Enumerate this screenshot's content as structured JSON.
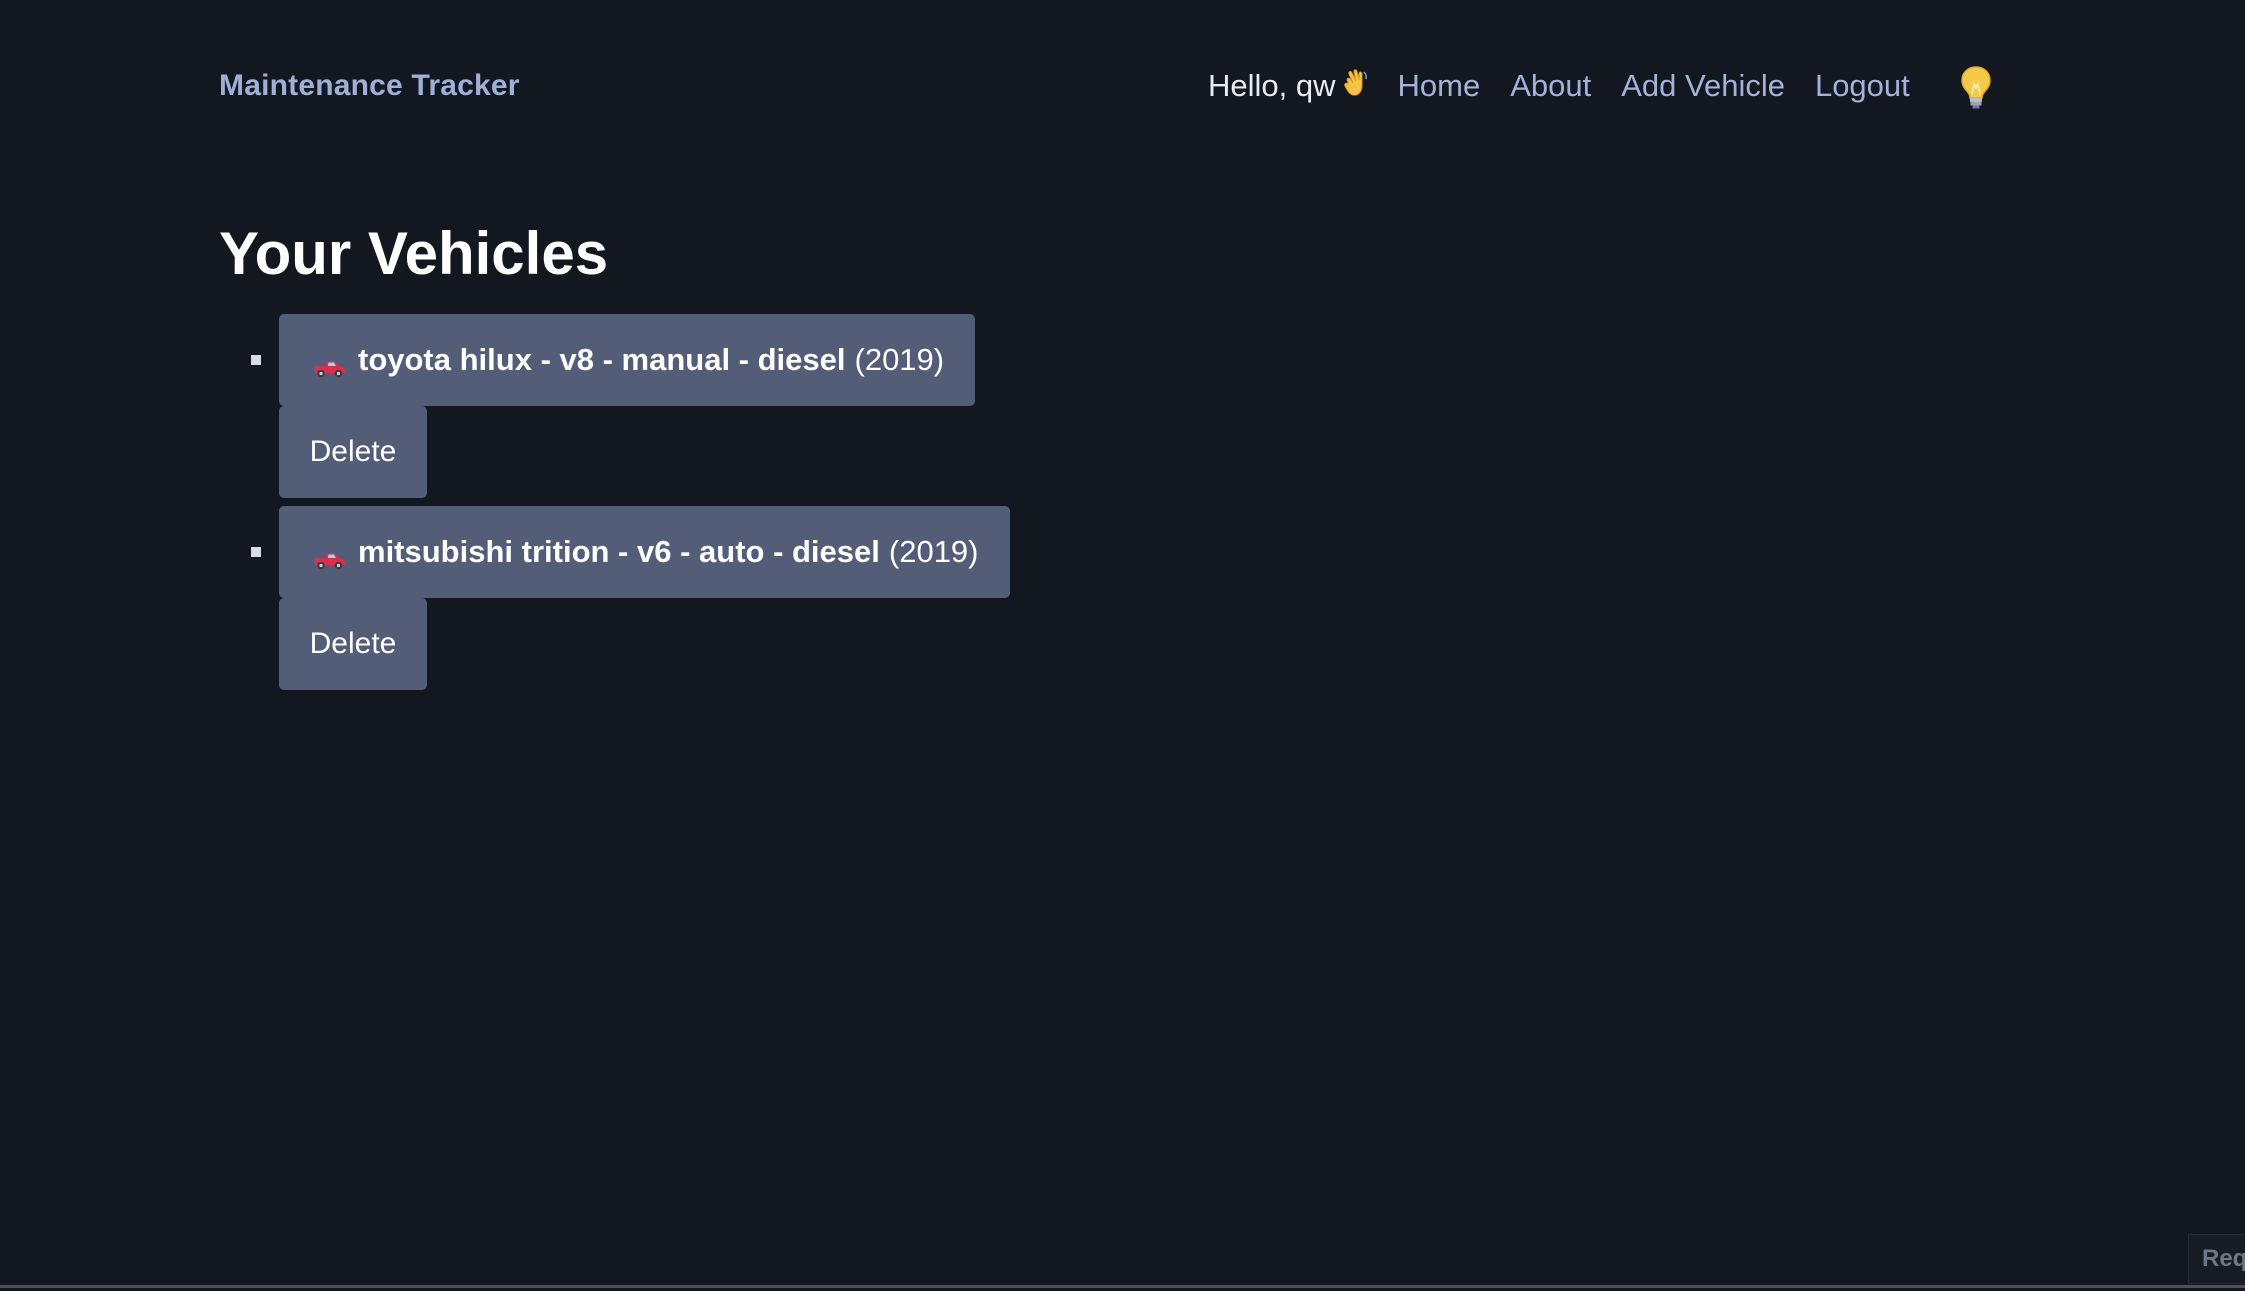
{
  "header": {
    "brand": "Maintenance Tracker",
    "greeting": "Hello, qw",
    "nav": {
      "home": "Home",
      "about": "About",
      "add_vehicle": "Add Vehicle",
      "logout": "Logout"
    },
    "icons": {
      "greeting": "waving-hand-icon",
      "theme_toggle": "light-bulb-icon"
    }
  },
  "main": {
    "title": "Your Vehicles",
    "vehicles": [
      {
        "icon": "pickup-truck-icon",
        "name": "toyota hilux - v8 - manual - diesel",
        "year": "(2019)",
        "delete_label": "Delete"
      },
      {
        "icon": "pickup-truck-icon",
        "name": "mitsubishi trition - v6 - auto - diesel",
        "year": "(2019)",
        "delete_label": "Delete"
      }
    ]
  },
  "corner": {
    "label": "Req"
  },
  "colors": {
    "background": "#131720",
    "brand": "#9fb0d6",
    "nav_link": "#a3b2d8",
    "card": "#535d78",
    "title": "#ffffff"
  }
}
